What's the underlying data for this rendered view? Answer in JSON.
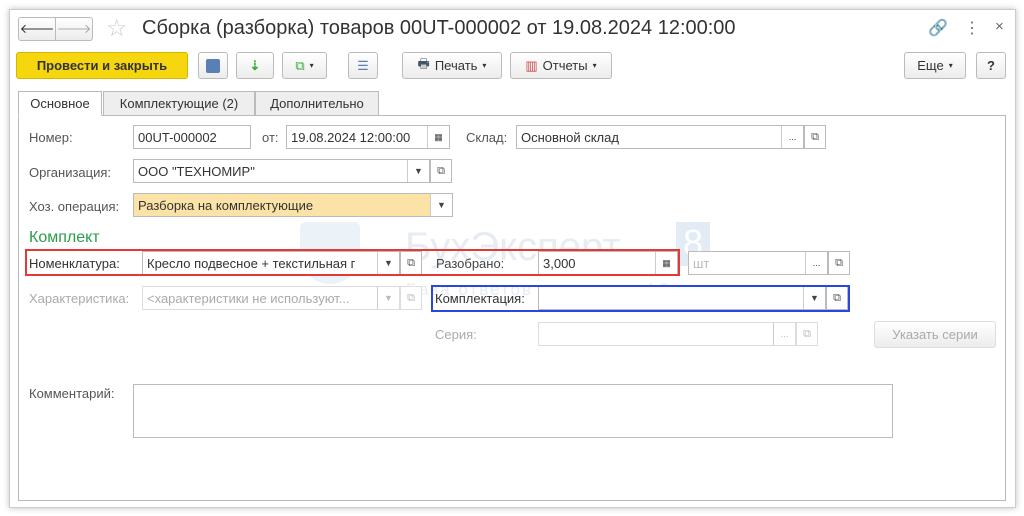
{
  "window": {
    "title": "Сборка (разборка) товаров 00UT-000002 от 19.08.2024 12:00:00"
  },
  "toolbar": {
    "post_close": "Провести и закрыть",
    "print": "Печать",
    "reports": "Отчеты",
    "more": "Еще",
    "help": "?"
  },
  "tabs": [
    "Основное",
    "Комплектующие (2)",
    "Дополнительно"
  ],
  "form": {
    "number_label": "Номер:",
    "number": "00UT-000002",
    "date_label": "от:",
    "date": "19.08.2024 12:00:00",
    "warehouse_label": "Склад:",
    "warehouse": "Основной склад",
    "org_label": "Организация:",
    "org": "ООО \"ТЕХНОМИР\"",
    "op_label": "Хоз. операция:",
    "op": "Разборка на комплектующие",
    "kit_section": "Комплект",
    "nomenclature_label": "Номенклатура:",
    "nomenclature": "Кресло подвесное + текстильная г",
    "disassembled_label": "Разобрано:",
    "disassembled": "3,000",
    "unit": "шт",
    "characteristic_label": "Характеристика:",
    "characteristic": "<характеристики не используют...",
    "kit_config_label": "Комплектация:",
    "kit_config": "",
    "series_label": "Серия:",
    "series": "",
    "specify_series": "Указать серии",
    "comment_label": "Комментарий:",
    "comment": ""
  },
  "watermark": {
    "brand": "БухЭксперт",
    "brand_num": "8",
    "tagline": "База ответов по учету в 1С"
  },
  "colors": {
    "accent_button": "#f5d60f",
    "section": "#2a9d4a",
    "highlight_red": "#e53935",
    "highlight_blue": "#2b45e0"
  }
}
